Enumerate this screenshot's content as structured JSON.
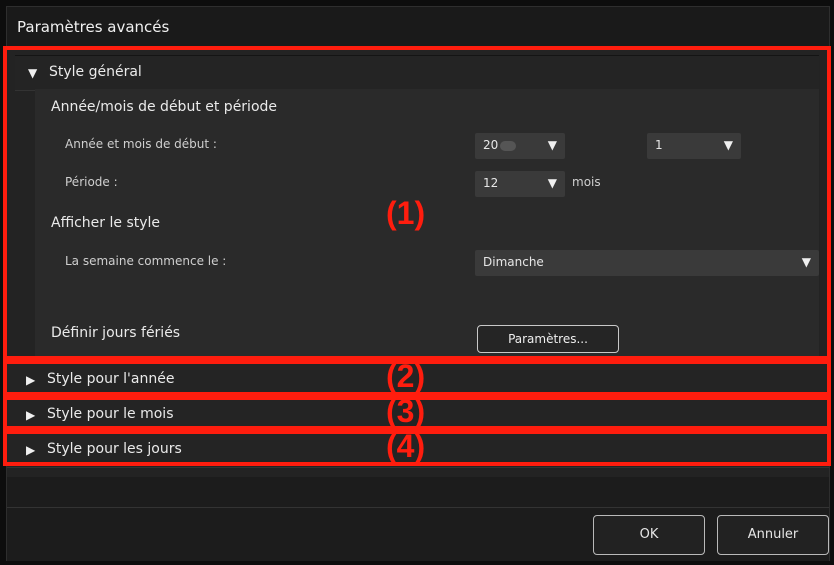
{
  "dialog": {
    "title": "Paramètres avancés"
  },
  "sections": {
    "general": {
      "label": "Style général"
    },
    "year": {
      "label": "Style pour l'année"
    },
    "month": {
      "label": "Style pour le mois"
    },
    "days": {
      "label": "Style pour les jours"
    }
  },
  "general": {
    "start_heading": "Année/mois de début et période",
    "start_label": "Année et mois de début :",
    "year_value": "20",
    "month_value": "1",
    "period_label": "Période :",
    "period_value": "12",
    "period_unit": "mois",
    "display_heading": "Afficher le style",
    "week_start_label": "La semaine commence le :",
    "week_start_value": "Dimanche",
    "holidays_label": "Définir jours fériés",
    "params_button": "Paramètres..."
  },
  "annotations": [
    "(1)",
    "(2)",
    "(3)",
    "(4)"
  ],
  "footer": {
    "ok": "OK",
    "cancel": "Annuler"
  },
  "icons": {
    "dropdown": "triangle-down-icon",
    "collapsed": "triangle-right-icon"
  },
  "colors": {
    "highlight": "#ff1d0e"
  }
}
